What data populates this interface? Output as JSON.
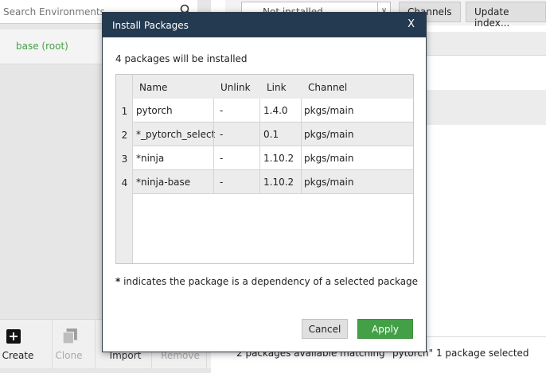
{
  "environments": {
    "search_placeholder": "Search Environments",
    "items": [
      {
        "label": "base (root)",
        "color": "#43a047"
      }
    ],
    "toolbar": {
      "create": "Create",
      "clone": "Clone",
      "import": "Import",
      "remove": "Remove"
    }
  },
  "packages": {
    "filter_value": "Not installed",
    "channels_label": "Channels",
    "update_index_label": "Update index...",
    "status": "2 packages available matching \"pytorch\"   1 package selected"
  },
  "dialog": {
    "title": "Install Packages",
    "close": "X",
    "message": "4 packages will be installed",
    "columns": [
      "Name",
      "Unlink",
      "Link",
      "Channel"
    ],
    "rows": [
      {
        "num": "1",
        "name": "pytorch",
        "unlink": "-",
        "link": "1.4.0",
        "channel": "pkgs/main"
      },
      {
        "num": "2",
        "name": "*_pytorch_select",
        "unlink": "-",
        "link": "0.1",
        "channel": "pkgs/main"
      },
      {
        "num": "3",
        "name": "*ninja",
        "unlink": "-",
        "link": "1.10.2",
        "channel": "pkgs/main"
      },
      {
        "num": "4",
        "name": "*ninja-base",
        "unlink": "-",
        "link": "1.10.2",
        "channel": "pkgs/main"
      }
    ],
    "note_star": "*",
    "note": " indicates the package is a dependency of a selected package",
    "cancel": "Cancel",
    "apply": "Apply"
  },
  "colors": {
    "title_bar": "#243a51",
    "accent_green": "#43a047"
  }
}
